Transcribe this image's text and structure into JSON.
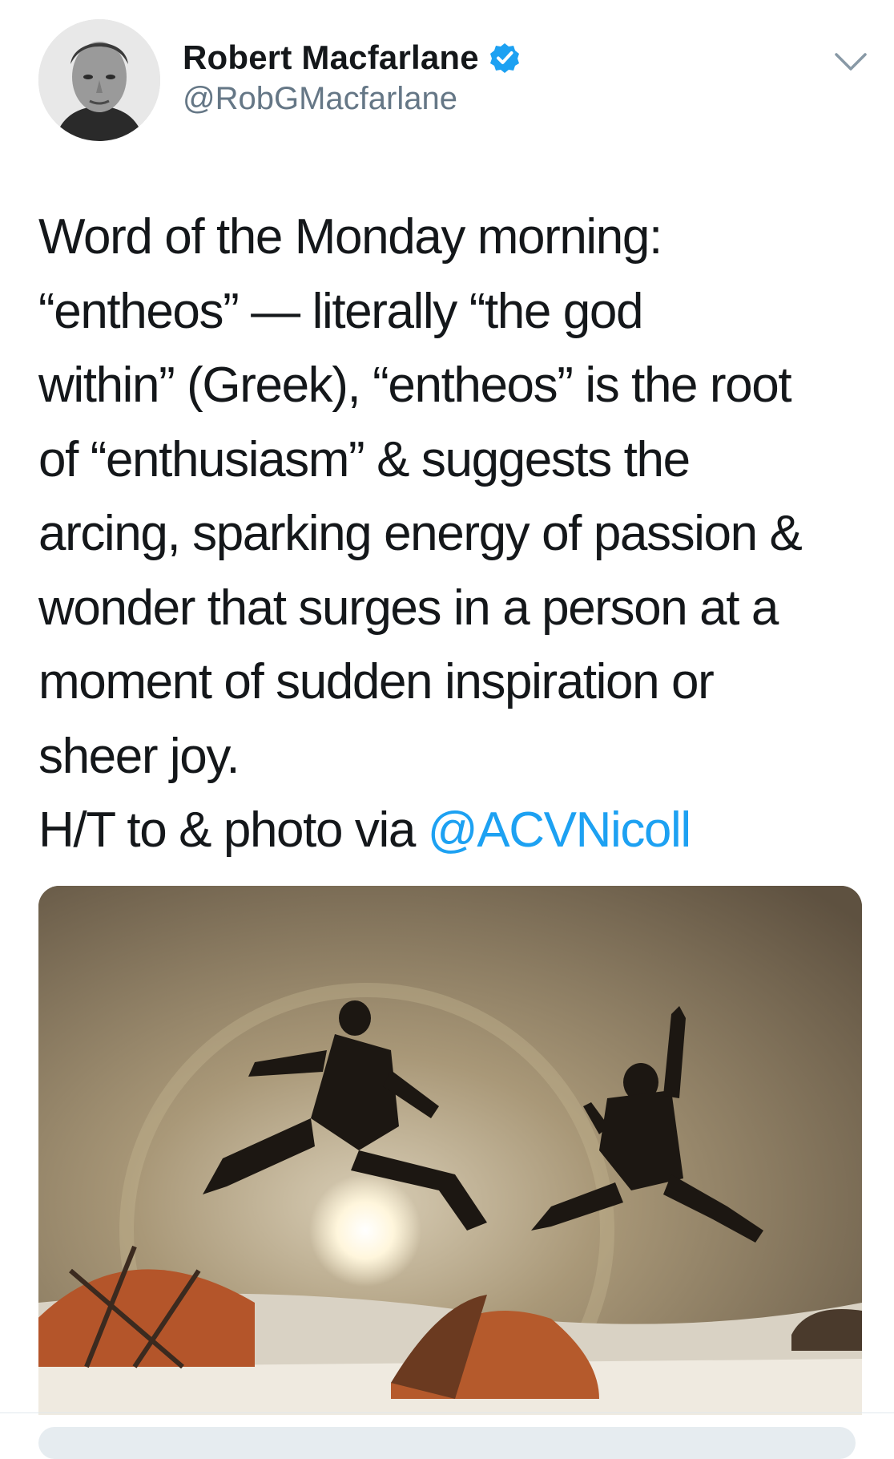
{
  "author": {
    "display_name": "Robert Macfarlane",
    "handle": "@RobGMacfarlane",
    "verified": true
  },
  "tweet": {
    "lines": [
      "Word of the Monday morning:",
      "“entheos” — literally “the god",
      "within” (Greek), “entheos” is the root",
      "of “enthusiasm” & suggests the",
      "arcing, sparking energy of passion &",
      "wonder that surges in a person at a",
      "moment of sudden inspiration or",
      "sheer joy."
    ],
    "last_line_prefix": "H/T to & photo via ",
    "mention": "@ACVNicoll"
  },
  "icons": {
    "verified": "verified-badge-icon",
    "more": "chevron-down-icon"
  },
  "colors": {
    "text": "#14171a",
    "secondary": "#657786",
    "link": "#1da1f2",
    "verified": "#1da1f2"
  }
}
